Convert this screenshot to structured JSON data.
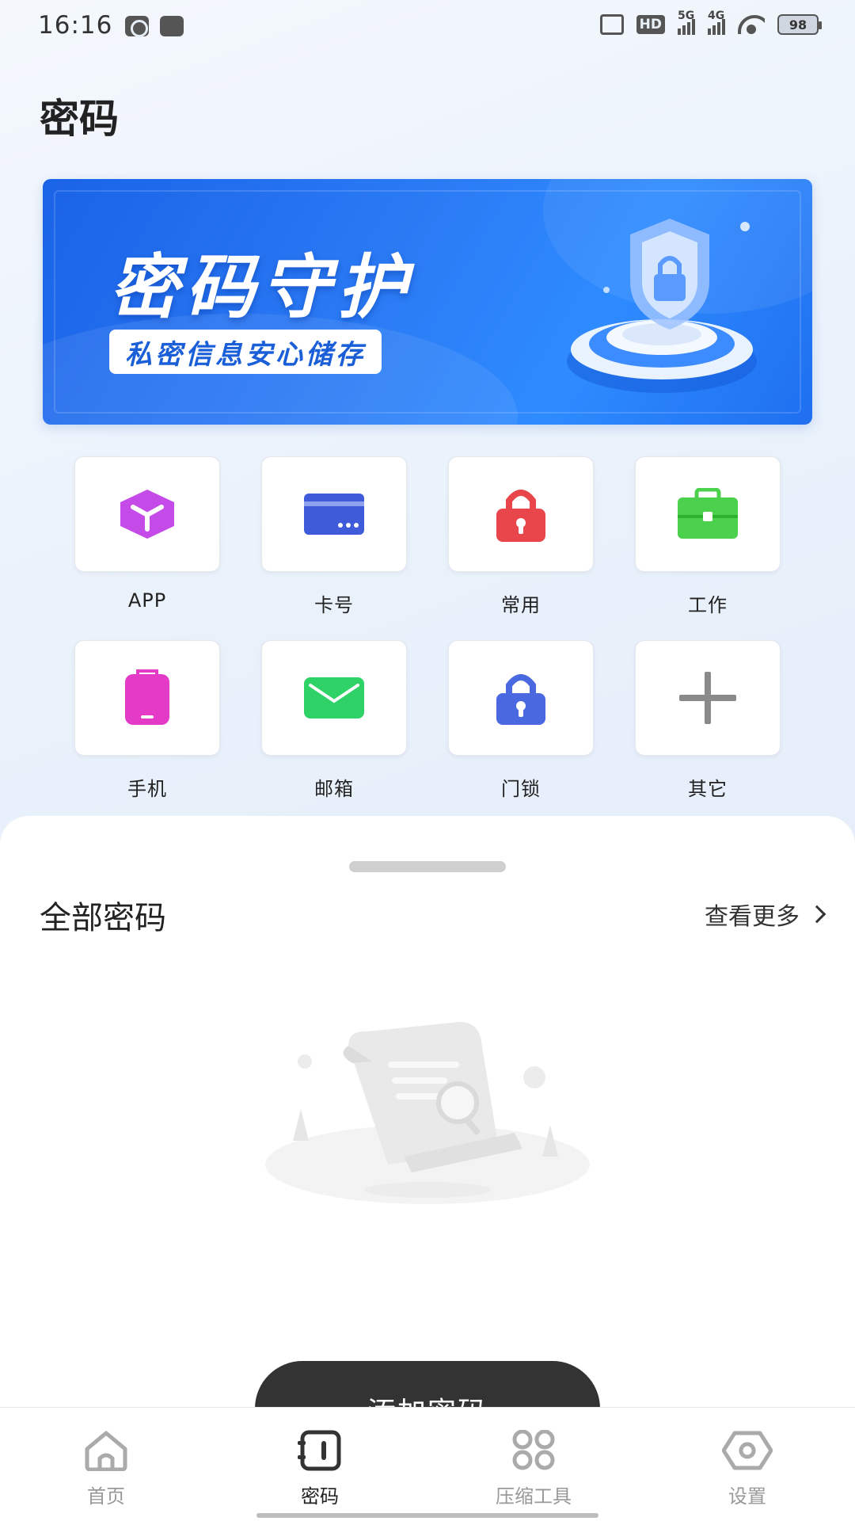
{
  "status_bar": {
    "time": "16:16",
    "hd_label": "HD",
    "net1_label": "5G",
    "net2_label": "4G",
    "battery": "98"
  },
  "header": {
    "title": "密码"
  },
  "banner": {
    "title": "密码守护",
    "subtitle": "私密信息安心储存"
  },
  "categories": [
    {
      "label": "APP",
      "icon": "cube-icon",
      "color": "#c44be8"
    },
    {
      "label": "卡号",
      "icon": "card-icon",
      "color": "#3f5bd9"
    },
    {
      "label": "常用",
      "icon": "lock-icon",
      "color": "#e8464a"
    },
    {
      "label": "工作",
      "icon": "briefcase-icon",
      "color": "#4cd14c"
    },
    {
      "label": "手机",
      "icon": "phone-icon",
      "color": "#e43ac8"
    },
    {
      "label": "邮箱",
      "icon": "mail-icon",
      "color": "#2fd267"
    },
    {
      "label": "门锁",
      "icon": "door-lock-icon",
      "color": "#4a68e0"
    },
    {
      "label": "其它",
      "icon": "plus-icon",
      "color": "#8a8a8a"
    }
  ],
  "all_passwords": {
    "title": "全部密码",
    "more_label": "查看更多"
  },
  "add_button": {
    "label": "添加密码"
  },
  "tabbar": {
    "items": [
      {
        "label": "首页",
        "icon": "home-icon",
        "active": false
      },
      {
        "label": "密码",
        "icon": "notebook-icon",
        "active": true
      },
      {
        "label": "压缩工具",
        "icon": "grid-icon",
        "active": false
      },
      {
        "label": "设置",
        "icon": "settings-hex-icon",
        "active": false
      }
    ]
  }
}
